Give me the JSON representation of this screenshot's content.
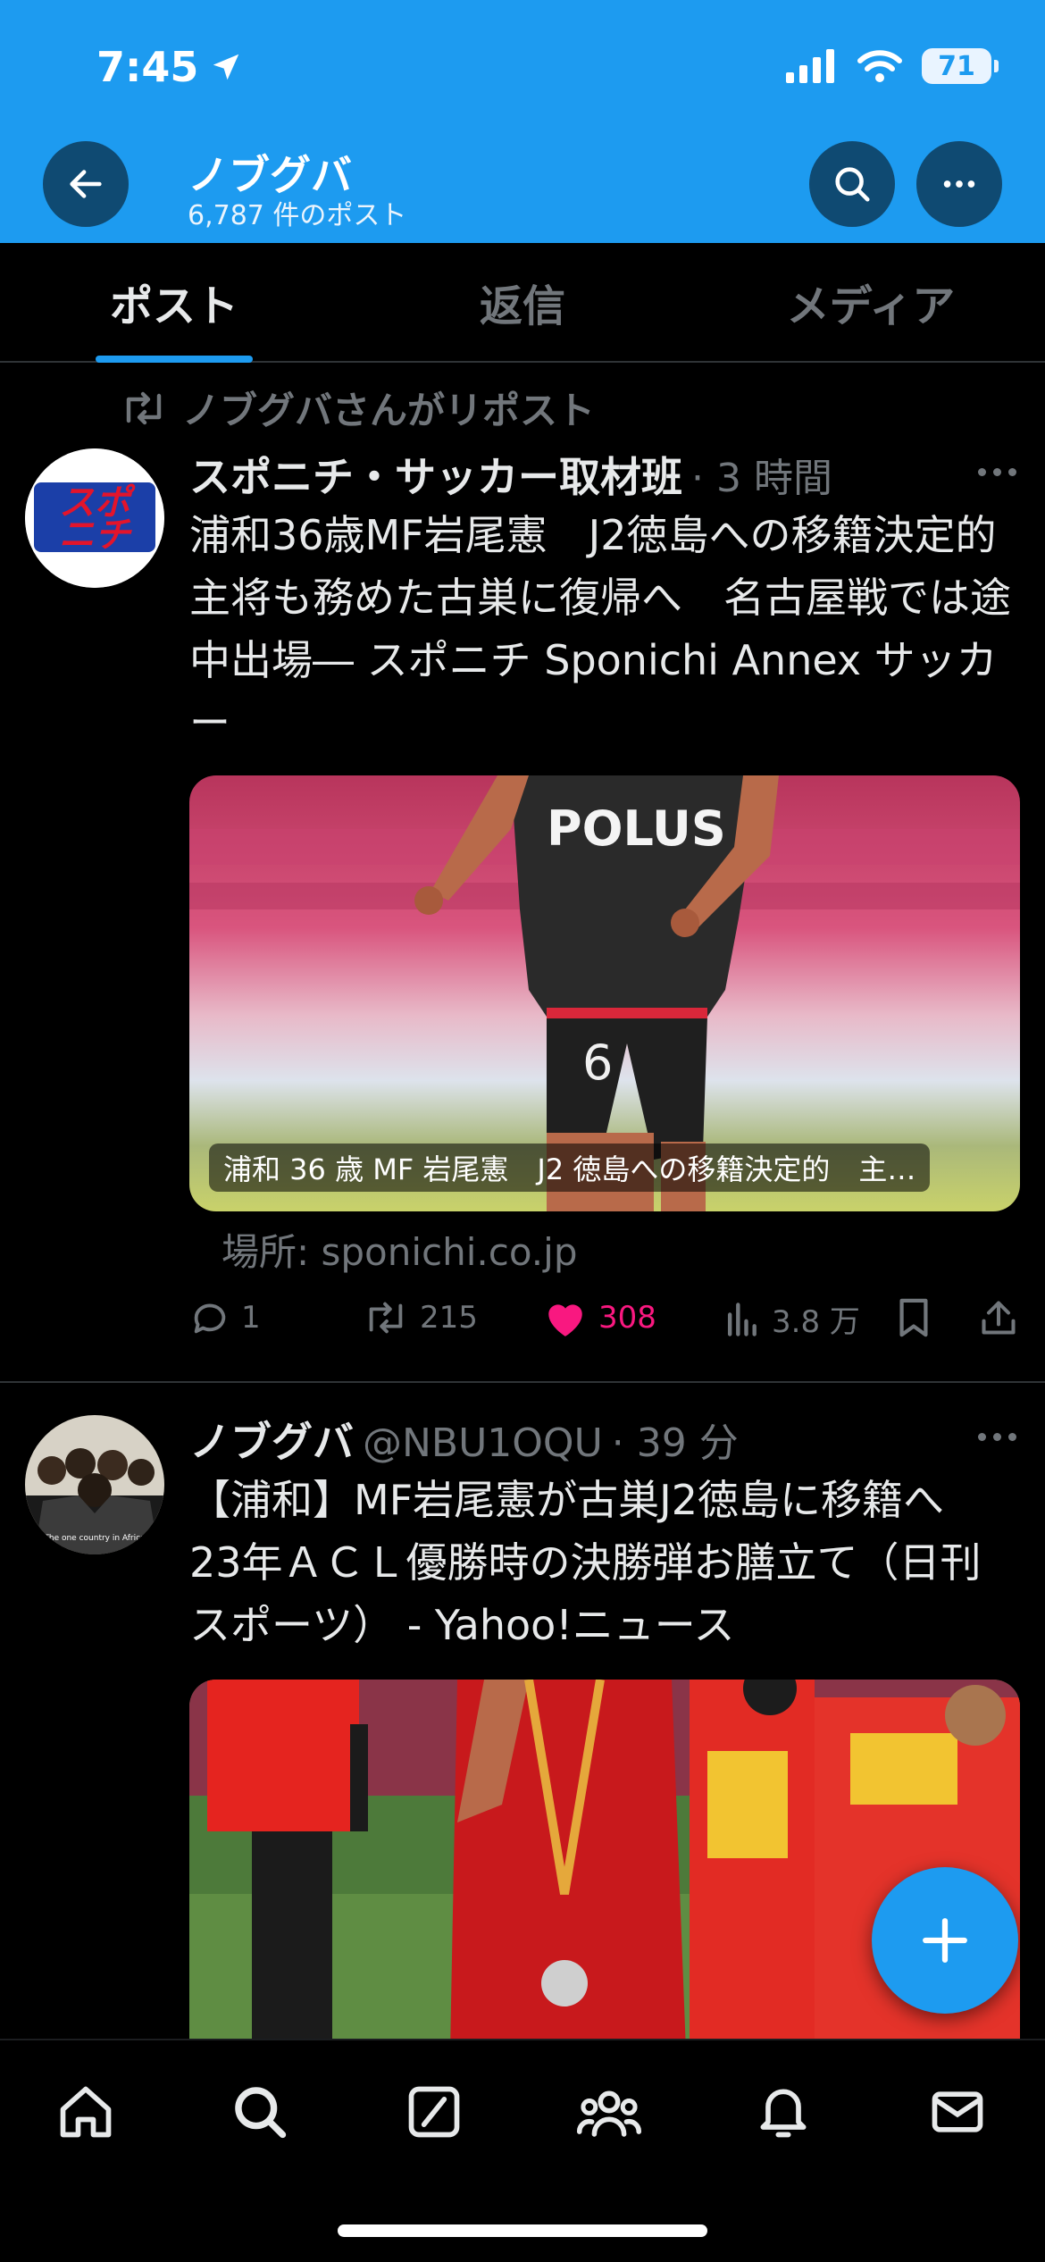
{
  "status_bar": {
    "time": "7:45",
    "battery": "71"
  },
  "header": {
    "title": "ノブグバ",
    "subtitle": "6,787 件のポスト"
  },
  "tabs": [
    {
      "label": "ポスト",
      "active": true
    },
    {
      "label": "返信",
      "active": false
    },
    {
      "label": "メディア",
      "active": false
    }
  ],
  "posts": [
    {
      "repost_label": "ノブグバさんがリポスト",
      "author": "スポニチ・サッカー取材班",
      "time": "· 3 時間",
      "avatar_text": [
        "スポ",
        "ニチ"
      ],
      "text": "浦和36歳MF岩尾憲　J2徳島への移籍決定的　主将も務めた古巣に復帰へ　名古屋戦では途中出場― スポニチ Sponichi Annex サッカー",
      "card_caption": "浦和 36 歳 MF 岩尾憲　J2 徳島への移籍決定的　主…",
      "jersey_sponsor": "POLUS",
      "jersey_number": "6",
      "link_source": "場所: sponichi.co.jp",
      "replies": "1",
      "reposts": "215",
      "likes": "308",
      "views": "3.8 万"
    },
    {
      "author": "ノブグバ",
      "handle": "@NBU1OQU",
      "time": "· 39 分",
      "avatar_caption": "The one country in Africa",
      "text": "【浦和】MF岩尾憲が古巣J2徳島に移籍へ　23年ＡＣＬ優勝時の決勝弾お膳立て（日刊スポーツ） - Yahoo!ニュース"
    }
  ],
  "colors": {
    "accent": "#1d9bf0",
    "like": "#f91880",
    "muted": "#71767b"
  }
}
